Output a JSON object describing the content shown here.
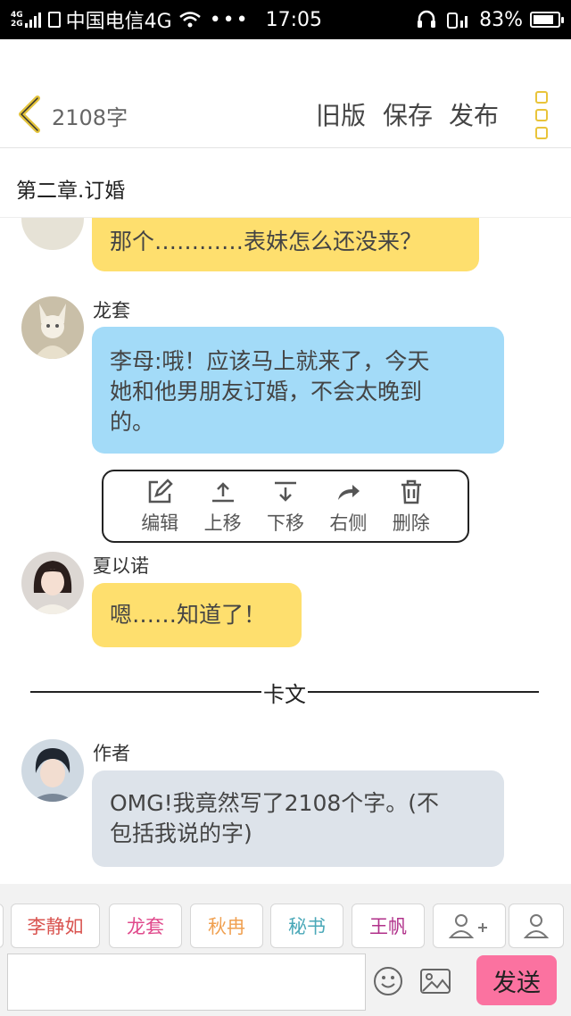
{
  "status_bar": {
    "network_top": "4G",
    "network_bottom": "2G",
    "carrier": "中国电信4G",
    "time": "17:05",
    "battery": "83%",
    "battery_level": 0.83
  },
  "header": {
    "word_count": "2108字",
    "actions": [
      "旧版",
      "保存",
      "发布"
    ]
  },
  "chapter_title": "第二章.订婚",
  "messages": [
    {
      "sender": "",
      "text": "那个…………表妹怎么还没来？"
    },
    {
      "sender": "龙套",
      "text_lines": [
        "李母:哦！应该马上就来了，今天",
        "她和他男朋友订婚，不会太晚到",
        "的。"
      ]
    },
    {
      "sender": "夏以诺",
      "text": "嗯……知道了！"
    },
    {
      "sender": "作者",
      "text_lines": [
        "OMG!我竟然写了2108个字。(不",
        "包括我说的字)"
      ]
    }
  ],
  "message_toolbar": [
    "编辑",
    "上移",
    "下移",
    "右侧",
    "删除"
  ],
  "divider_label": "卡文",
  "characters": [
    {
      "name": "李静如",
      "color": "#d9534f"
    },
    {
      "name": "龙套",
      "color": "#e04a8c"
    },
    {
      "name": "秋冉",
      "color": "#f0a050"
    },
    {
      "name": "秘书",
      "color": "#4aa8b8"
    },
    {
      "name": "王帆",
      "color": "#b0308a"
    }
  ],
  "input": {
    "placeholder": "",
    "send_label": "发送"
  }
}
